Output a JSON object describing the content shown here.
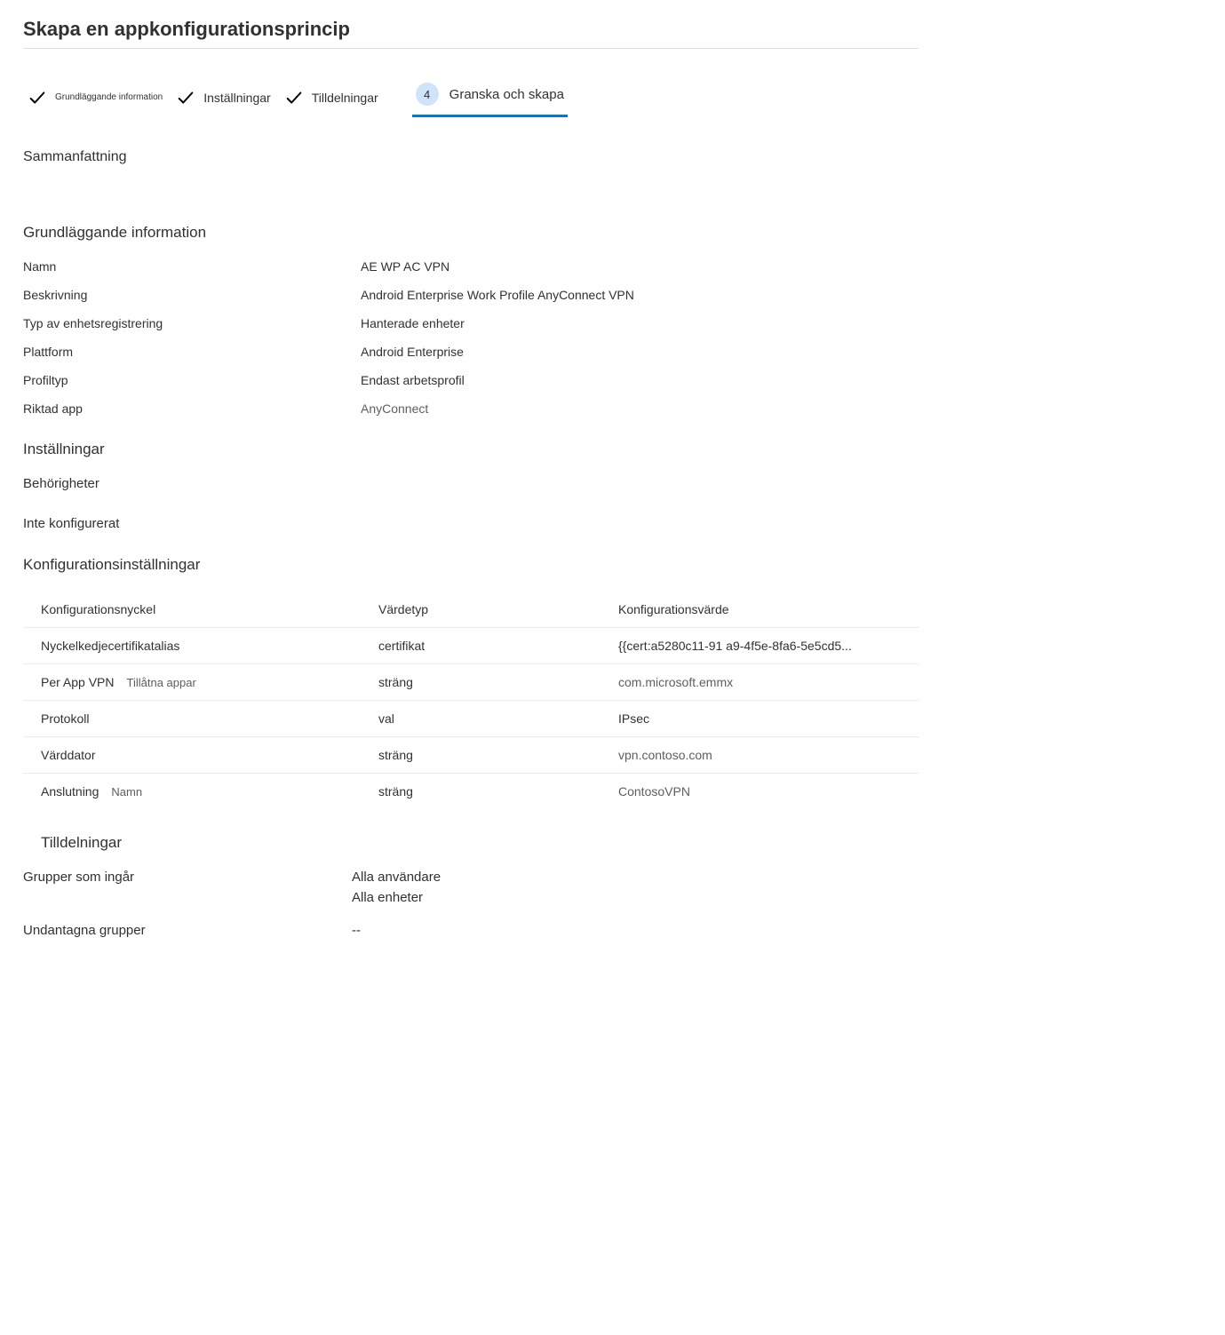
{
  "page": {
    "title": "Skapa en appkonfigurationsprincip"
  },
  "steps": {
    "done": [
      {
        "label": "Grundläggande information",
        "small": true
      },
      {
        "label": "Inställningar",
        "small": false
      },
      {
        "label": "Tilldelningar",
        "small": false
      }
    ],
    "current": {
      "num": "4",
      "label": "Granska och skapa"
    }
  },
  "summary": {
    "heading": "Sammanfattning"
  },
  "basics": {
    "heading": "Grundläggande information",
    "rows": [
      {
        "label": "Namn",
        "value": "AE WP AC VPN"
      },
      {
        "label": "Beskrivning",
        "value": "Android Enterprise Work Profile AnyConnect VPN"
      },
      {
        "label": "Typ av enhetsregistrering",
        "value": "Hanterade enheter"
      },
      {
        "label": "Plattform",
        "value": "Android Enterprise"
      },
      {
        "label": "Profiltyp",
        "value": "Endast arbetsprofil"
      },
      {
        "label": "Riktad app",
        "value": "AnyConnect",
        "muted": true
      }
    ]
  },
  "settings": {
    "heading": "Inställningar",
    "permissions_label": "Behörigheter",
    "not_configured": "Inte konfigurerat"
  },
  "config": {
    "heading": "Konfigurationsinställningar",
    "columns": {
      "key": "Konfigurationsnyckel",
      "type": "Värdetyp",
      "value": "Konfigurationsvärde"
    },
    "rows": [
      {
        "key": "Nyckelkedjecertifikatalias",
        "sub": "",
        "type": "certifikat",
        "value": "{{cert:a5280c11-91 a9-4f5e-8fa6-5e5cd5..."
      },
      {
        "key": "Per App VPN",
        "sub": "Tillåtna appar",
        "type": "sträng",
        "value": "com.microsoft.emmx",
        "muted": true
      },
      {
        "key": "Protokoll",
        "sub": "",
        "type": "val",
        "value": "IPsec"
      },
      {
        "key": "Värddator",
        "sub": "",
        "type": "sträng",
        "value": "vpn.contoso.com",
        "muted": true
      },
      {
        "key": "Anslutning",
        "sub": "Namn",
        "type": "sträng",
        "value": "ContosoVPN",
        "muted": true
      }
    ]
  },
  "assignments": {
    "heading": "Tilldelningar",
    "included_label": "Grupper som ingår",
    "included_values": [
      "Alla användare",
      "Alla enheter"
    ],
    "excluded_label": "Undantagna grupper",
    "excluded_value": "--"
  }
}
